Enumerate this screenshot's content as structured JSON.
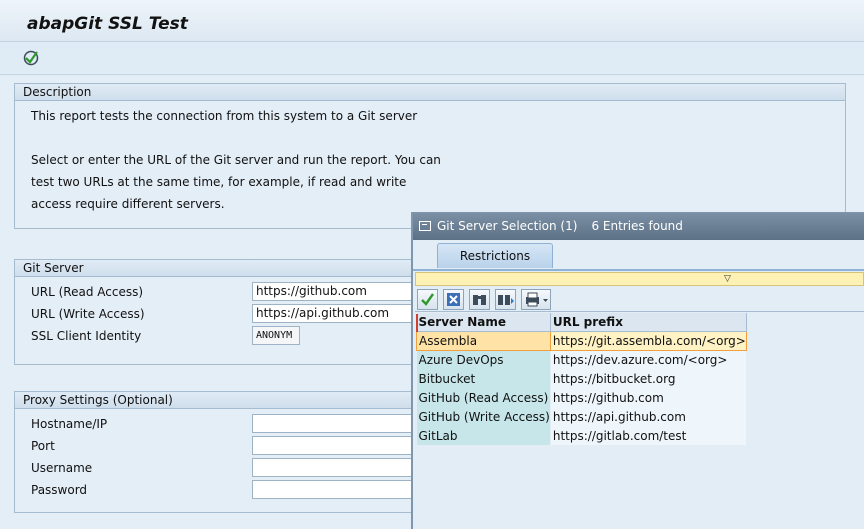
{
  "window": {
    "title": "abapGit SSL Test"
  },
  "toolbar": {
    "execute_icon": "execute-icon"
  },
  "description": {
    "header": "Description",
    "lines": [
      "This report tests the connection from this system to a Git server",
      "",
      "Select or enter the URL of the Git server and run the report. You can",
      "test two URLs at the same time, for example, if read and write",
      "access require different servers."
    ]
  },
  "git_server": {
    "header": "Git Server",
    "url_read_label": "URL (Read Access)",
    "url_read_value": "https://github.com",
    "url_write_label": "URL (Write Access)",
    "url_write_value": "https://api.github.com",
    "ssl_label": "SSL Client Identity",
    "ssl_value": "ANONYM"
  },
  "proxy": {
    "header": "Proxy Settings (Optional)",
    "host_label": "Hostname/IP",
    "port_label": "Port",
    "user_label": "Username",
    "pass_label": "Password"
  },
  "popup": {
    "title": "Git Server Selection (1)",
    "entries_found": "6 Entries found",
    "tab_label": "Restrictions",
    "columns": [
      "Server Name",
      "URL prefix"
    ],
    "rows": [
      [
        "Assembla",
        "https://git.assembla.com/<org>"
      ],
      [
        "Azure DevOps",
        "https://dev.azure.com/<org>"
      ],
      [
        "Bitbucket",
        "https://bitbucket.org"
      ],
      [
        "GitHub (Read Access)",
        "https://github.com"
      ],
      [
        "GitHub (Write Access)",
        "https://api.github.com"
      ],
      [
        "GitLab",
        "https://gitlab.com/test"
      ]
    ],
    "selected_row": 0,
    "toolbar_icons": [
      "confirm-icon",
      "cancel-icon",
      "find-icon",
      "find-next-icon",
      "print-icon"
    ]
  },
  "colors": {
    "accent": "#5c7086",
    "selection": "#fff2c4",
    "key_cell": "#c6e6ea"
  }
}
